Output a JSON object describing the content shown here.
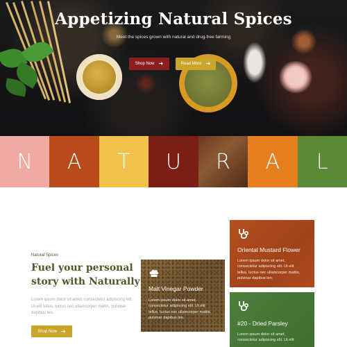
{
  "hero": {
    "title": "Appetizing Natural Spices",
    "subtitle": "Meet the spices grown with natural and drug-free farming",
    "shop_label": "Shop Now",
    "read_label": "Read More"
  },
  "strip": {
    "letters": [
      "N",
      "A",
      "T",
      "U",
      "R",
      "A",
      "L"
    ]
  },
  "intro": {
    "eyebrow": "Natural Spices",
    "heading": "Fuel your personal story with Naturally",
    "paragraph": "Lorem ipsum dolor sit amet, consectetur adipiscing elit. Ut elit tellus, luctus nec ullamcorper mattis, pulvinar dapibus leo.",
    "shop_label": "Shop Now"
  },
  "cards": {
    "malt": {
      "title": "Malt Vinegar Powder",
      "body": "Lorem ipsum dolor sit amet, consectetur adipiscing elit. Ut elit tellus, luctus nec ullamcorper mattis, pulvinar dapibus leo."
    },
    "oriental": {
      "title": "Oriental Mustard Flower",
      "body": "Lorem ipsum dolor sit amet, consectetur adipiscing elit. Ut elit tellus, luctus nec ullamcorper mattis, pulvinar dapibus leo."
    },
    "parsley": {
      "title": "#20 - Dried Parsley",
      "body": "Lorem ipsum dolor sit amet, consectetur adipiscing elit. Ut elit"
    }
  },
  "colors": {
    "burgundy": "#8b1e1f",
    "mustard": "#c9a52a",
    "olive": "#4a5a26",
    "rust": "#a1421a",
    "green": "#4d7f3b"
  },
  "icons": [
    "arrow-right-icon",
    "chef-hat-icon",
    "stethoscope-icon"
  ]
}
